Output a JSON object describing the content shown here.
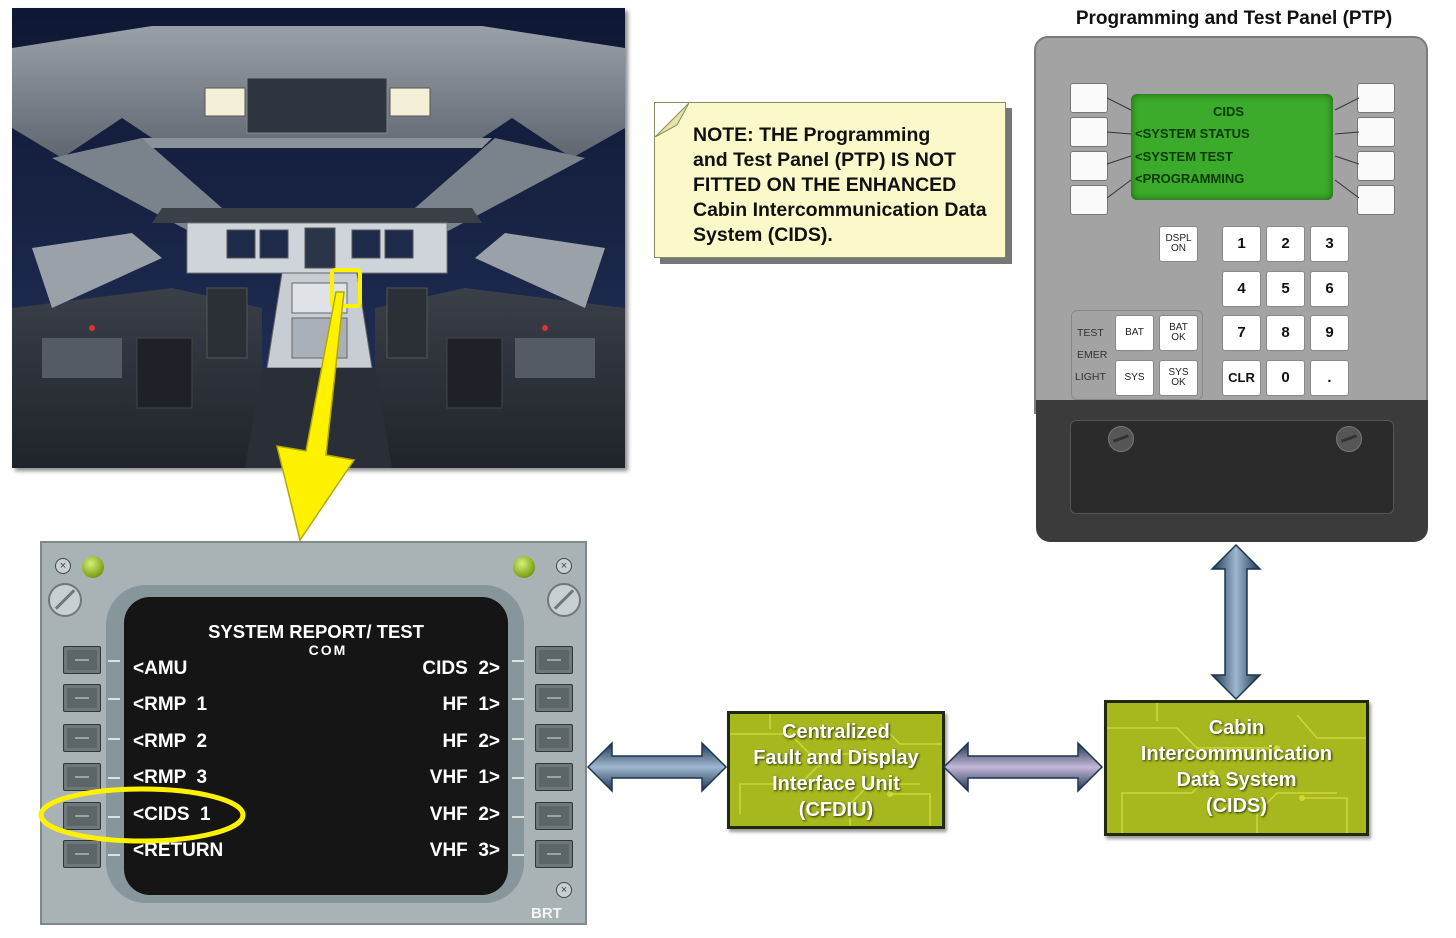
{
  "note": {
    "lines": [
      "NOTE: THE Programming",
      "and Test Panel (PTP) IS NOT",
      "FITTED ON THE ENHANCED",
      "Cabin Intercommunication Data",
      "System (CIDS)."
    ]
  },
  "ptp": {
    "title": "Programming and Test Panel (PTP)",
    "screen_lines": [
      "CIDS",
      "<SYSTEM STATUS",
      "<SYSTEM TEST",
      "<PROGRAMMING"
    ],
    "dspl_key": [
      "DSPL",
      "ON"
    ],
    "keypad": [
      "1",
      "2",
      "3",
      "4",
      "5",
      "6",
      "7",
      "8",
      "9",
      "CLR",
      "0",
      "."
    ],
    "side_labels": [
      "TEST",
      "EMER",
      "LIGHT"
    ],
    "bat_key": "BAT",
    "bat_ok_key": [
      "BAT",
      "OK"
    ],
    "sys_key": "SYS",
    "sys_ok_key": [
      "SYS",
      "OK"
    ]
  },
  "mcdu": {
    "title": "SYSTEM REPORT/ TEST",
    "subtitle": "COM",
    "left_items": [
      "<AMU",
      "<RMP  1",
      "<RMP  2",
      "<RMP  3",
      "<CIDS  1",
      "<RETURN"
    ],
    "right_items": [
      "CIDS  2>",
      "HF  1>",
      "HF  2>",
      "VHF  1>",
      "VHF  2>",
      "VHF  3>"
    ],
    "brt_label": "BRT",
    "highlighted_item": "<CIDS  1"
  },
  "cfdiu_box": {
    "lines": [
      "Centralized",
      "Fault and Display",
      "Interface Unit",
      "(CFDIU)"
    ]
  },
  "cids_box": {
    "lines": [
      "Cabin",
      "Intercommunication",
      "Data System",
      "(CIDS)"
    ]
  },
  "colors": {
    "callout_yellow": "#fff200",
    "pcb_green": "#a6b81e",
    "arrow_blue": "#2d4a6a",
    "ptp_screen": "#3caa2a"
  }
}
